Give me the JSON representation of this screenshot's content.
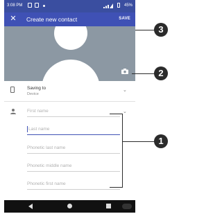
{
  "status_bar": {
    "time": "3:08 PM",
    "battery": "45%"
  },
  "toolbar": {
    "title": "Create new contact",
    "save_label": "SAVE"
  },
  "form": {
    "saving_to_label": "Saving to",
    "saving_to_value": "Device",
    "fields": [
      {
        "placeholder": "First name"
      },
      {
        "placeholder": "Last name"
      },
      {
        "placeholder": "Phonetic last name"
      },
      {
        "placeholder": "Phonetic middle name"
      },
      {
        "placeholder": "Phonetic first name"
      }
    ]
  },
  "callouts": [
    "3",
    "2",
    "1"
  ],
  "colors": {
    "status_bar": "#3a4ea0",
    "toolbar": "#3f51b5",
    "photo_bg": "#8c98a3",
    "nav_bar": "#111111"
  },
  "icons": [
    "close-icon",
    "camera-icon",
    "phone-icon",
    "person-icon",
    "chevron-down-icon",
    "back-icon",
    "home-icon",
    "recents-icon"
  ]
}
